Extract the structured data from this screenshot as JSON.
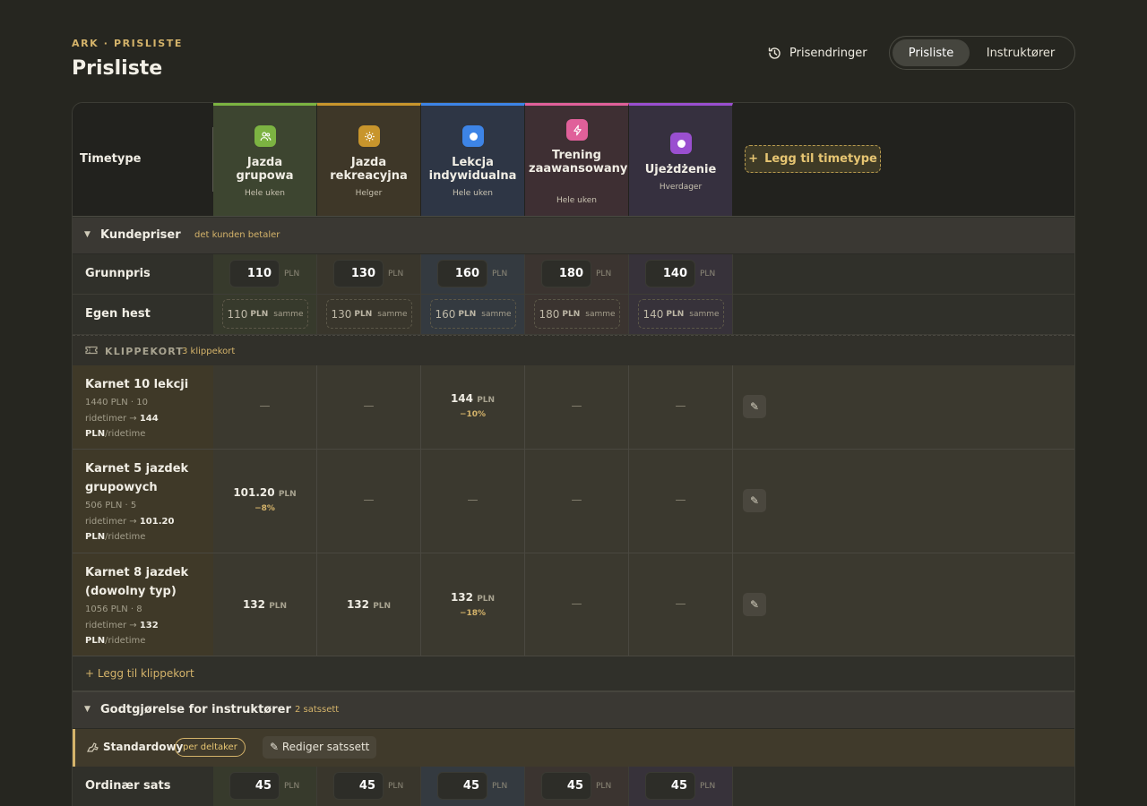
{
  "header": {
    "eyebrow": "ARK · PRISLISTE",
    "title": "Prisliste",
    "history_label": "Prisendringer"
  },
  "view_switch": {
    "active": "Prisliste",
    "other": "Instruktører"
  },
  "table": {
    "row_header_label": "Timetype",
    "add_type_label": "Legg til timetype",
    "types": [
      {
        "name": "Jazda grupowa",
        "when": "Hele uken",
        "color": "#7cb342",
        "icon": "people-icon"
      },
      {
        "name": "Jazda rekreacyjna",
        "when": "Helger",
        "color": "#c8952c",
        "icon": "sun-icon"
      },
      {
        "name": "Lekcja indywidualna",
        "when": "Hele uken",
        "color": "#3d84e6",
        "icon": "circle-icon"
      },
      {
        "name": "Trening zaawansowany",
        "when": "Hele uken",
        "color": "#e0609a",
        "icon": "bolt-icon"
      },
      {
        "name": "Ujeżdżenie",
        "when": "Hverdager",
        "color": "#9a4fd0",
        "icon": "circle-icon"
      }
    ]
  },
  "customer_prices": {
    "title": "Kundepriser",
    "subtitle": "det kunden betaler",
    "base_label": "Grunnpris",
    "base": [
      "110",
      "130",
      "160",
      "180",
      "140"
    ],
    "own_horse_label": "Egen hest",
    "own_horse": [
      "110",
      "130",
      "160",
      "180",
      "140"
    ],
    "currency": "PLN",
    "same_label": "samme"
  },
  "clip_cards": {
    "title": "KLIPPEKORT",
    "count": "3 klippekort",
    "per_label": "/ridetime",
    "cards": [
      {
        "name": "Karnet 10 lekcji",
        "desc_a": "1440 PLN · 10",
        "desc_b": "ridetimer → ",
        "desc_bold": "144",
        "cells": [
          {
            "v": "—"
          },
          {
            "v": "—"
          },
          {
            "v": "144",
            "pct": "−10%"
          },
          {
            "v": "—"
          },
          {
            "v": "—"
          }
        ]
      },
      {
        "name": "Karnet 5 jazdek grupowych",
        "desc_a": "506 PLN · 5",
        "desc_b": "ridetimer → ",
        "desc_bold": "101.20",
        "cells": [
          {
            "v": "101.20",
            "pct": "−8%"
          },
          {
            "v": "—"
          },
          {
            "v": "—"
          },
          {
            "v": "—"
          },
          {
            "v": "—"
          }
        ]
      },
      {
        "name": "Karnet 8 jazdek (dowolny typ)",
        "desc_a": "1056 PLN · 8",
        "desc_b": "ridetimer → ",
        "desc_bold": "132",
        "cells": [
          {
            "v": "132"
          },
          {
            "v": "132"
          },
          {
            "v": "132",
            "pct": "−18%"
          },
          {
            "v": "—"
          },
          {
            "v": "—"
          }
        ]
      }
    ],
    "add_label": "+ Legg til klippekort"
  },
  "instructor_pay": {
    "title": "Godtgjørelse for instruktører",
    "subtitle": "2 satssett",
    "set_name": "Standardowy",
    "set_mode": "per deltaker",
    "edit_label": "✎ Rediger satssett",
    "ordinary_label": "Ordinær sats",
    "ordinary": [
      "45",
      "45",
      "45",
      "45",
      "45"
    ]
  },
  "colors": {
    "accent": "#d4b36a",
    "background": "#262620",
    "panel": "#30302a"
  }
}
